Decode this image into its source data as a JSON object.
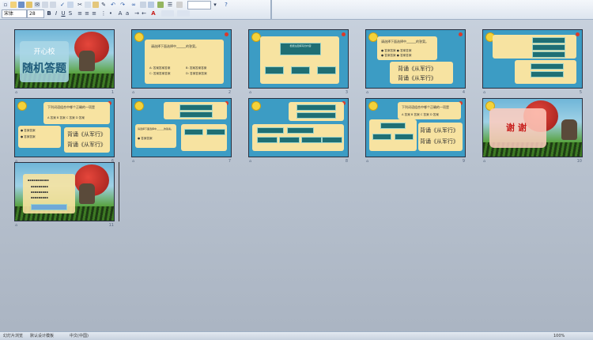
{
  "toolbar": {
    "font_name": "宋体",
    "font_size": "28",
    "row1_icons": [
      "new-icon",
      "open-icon",
      "save-icon",
      "permission-icon",
      "email-icon",
      "print-icon",
      "preview-icon",
      "spelling-icon",
      "research-icon",
      "cut-icon",
      "copy-icon",
      "paste-icon",
      "format-painter-icon",
      "undo-icon",
      "redo-icon",
      "hyperlink-icon",
      "table-icon",
      "chart-icon",
      "insert-image-icon",
      "expand-icon",
      "grayscale-icon",
      "zoom-icon",
      "help-icon"
    ],
    "row2_icons": [
      "bold-icon",
      "italic-icon",
      "underline-icon",
      "shadow-icon",
      "align-left-icon",
      "align-center-icon",
      "align-right-icon",
      "numbering-icon",
      "bullets-icon",
      "increase-font-icon",
      "decrease-font-icon",
      "indent-icon",
      "outdent-icon",
      "font-color-icon",
      "design-icon",
      "new-slide-icon"
    ]
  },
  "slides": [
    {
      "num": "1",
      "type": "title",
      "line1": "开心校",
      "line2": "随机答题"
    },
    {
      "num": "2",
      "type": "question",
      "prompt": "请选择下面选择中______的答案。",
      "options": [
        "A: 答案答案答案",
        "B: 答案答案答案",
        "C: 答案答案答案",
        "D: 答案答案答案"
      ]
    },
    {
      "num": "3",
      "type": "diagram1",
      "header": "根据左图填写的内容"
    },
    {
      "num": "4",
      "type": "recite",
      "prompt": "请选择下面选择中______的答案。",
      "notes": [
        "背诵《从军行》",
        "背诵《从军行》"
      ]
    },
    {
      "num": "5",
      "type": "diagram2"
    },
    {
      "num": "6",
      "type": "mixed",
      "prompt": "下列词语组合中哪个正确的一项是",
      "opts": "A 答案  B 答案  C 答案  D 答案",
      "notes": [
        "背诵《从军行》",
        "背诵《从军行》"
      ]
    },
    {
      "num": "7",
      "type": "diagram3",
      "prompt": "请选择下面选择中______的答案。"
    },
    {
      "num": "8",
      "type": "diagram4"
    },
    {
      "num": "9",
      "type": "mixed2",
      "prompt": "下列词语组合中哪个正确的一项是",
      "notes": [
        "背诵《从军行》",
        "背诵《从军行》"
      ]
    },
    {
      "num": "10",
      "type": "thanks",
      "text": "谢谢"
    },
    {
      "num": "11",
      "type": "final"
    }
  ],
  "status": {
    "view": "幻灯片浏览",
    "template": "默认设计模板",
    "language": "中文(中国)",
    "zoom": "100%"
  }
}
